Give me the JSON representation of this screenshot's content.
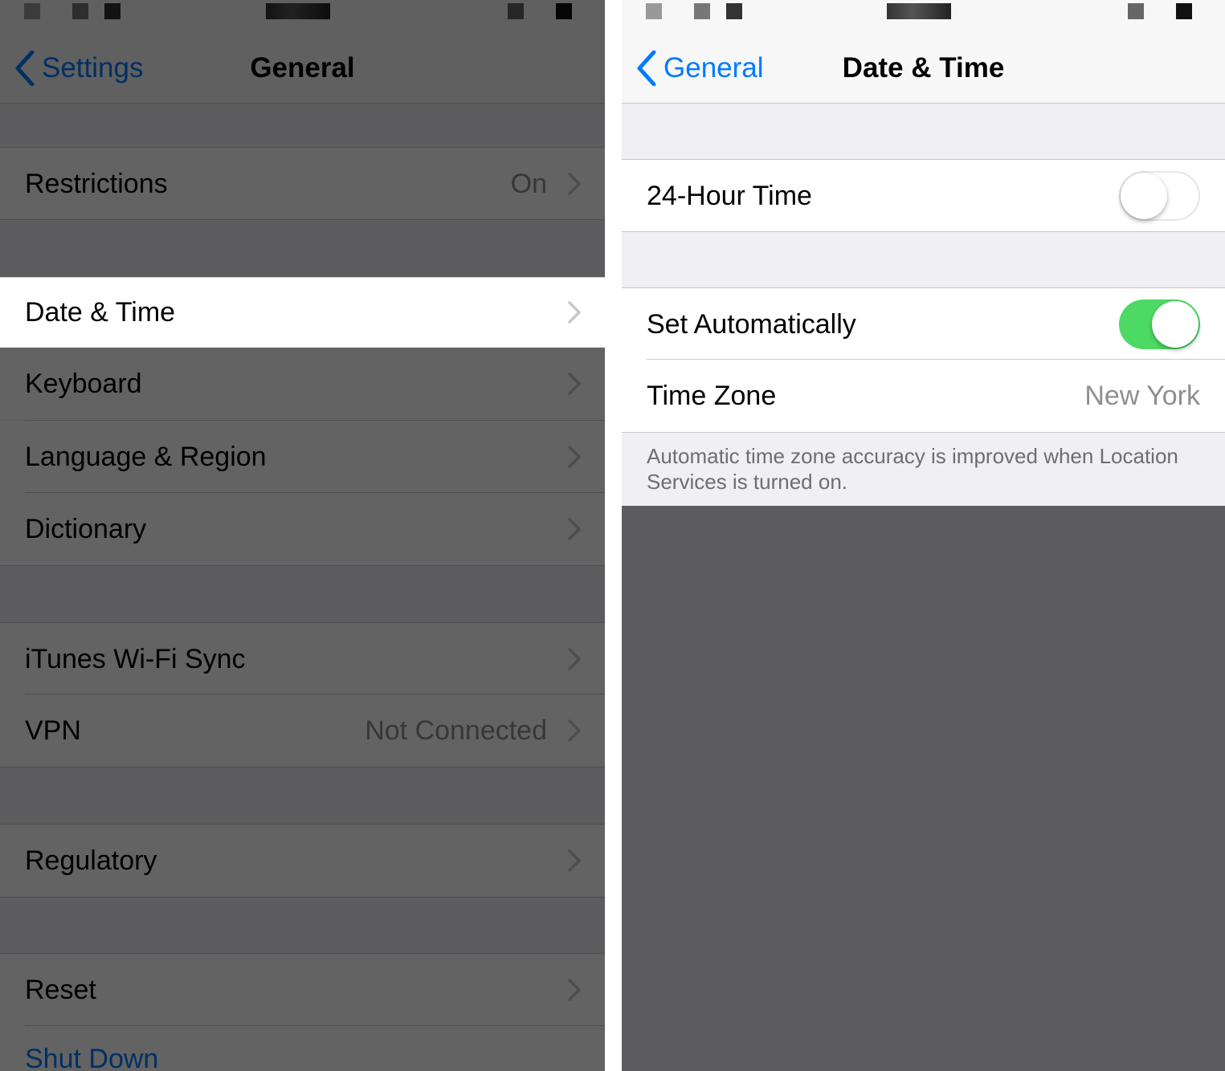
{
  "left": {
    "back_label": "Settings",
    "title": "General",
    "rows": [
      {
        "label": "Restrictions",
        "value": "On"
      },
      {
        "label": "Date & Time",
        "value": ""
      },
      {
        "label": "Keyboard",
        "value": ""
      },
      {
        "label": "Language & Region",
        "value": ""
      },
      {
        "label": "Dictionary",
        "value": ""
      },
      {
        "label": "iTunes Wi-Fi Sync",
        "value": ""
      },
      {
        "label": "VPN",
        "value": "Not Connected"
      },
      {
        "label": "Regulatory",
        "value": ""
      },
      {
        "label": "Reset",
        "value": ""
      },
      {
        "label": "Shut Down",
        "value": ""
      }
    ]
  },
  "right": {
    "back_label": "General",
    "title": "Date & Time",
    "hour24": {
      "label": "24-Hour Time",
      "on": false
    },
    "set_auto": {
      "label": "Set Automatically",
      "on": true
    },
    "timezone": {
      "label": "Time Zone",
      "value": "New York"
    },
    "footer": "Automatic time zone accuracy is improved when Location Services is turned on."
  },
  "colors": {
    "accent": "#007aff",
    "toggle_on": "#4cd964",
    "group_bg": "#efeff4",
    "dim_overlay": "rgba(0,0,0,0.61)"
  }
}
